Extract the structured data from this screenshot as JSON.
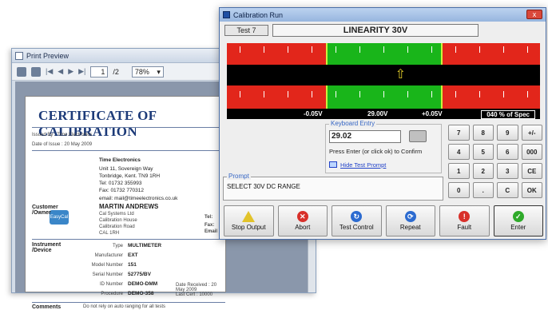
{
  "print_preview": {
    "title": "Print Preview",
    "page_current": "1",
    "page_total": "/2",
    "zoom": "78%",
    "certificate": {
      "title": "CERTIFICATE OF CALIBRATION",
      "issued_by": "Issued By : Time Electronics",
      "date_of_issue": "Date of Issue : 20 May 2009",
      "company": "Time Electronics",
      "address1": "Unit 11, Sovereign Way",
      "address2": "Tonbridge, Kent. TN9 1RH",
      "tel": "Tel: 01732 355993",
      "fax": "Fax: 01732 770312",
      "email": "email: mail@timeelectronics.co.uk",
      "logo_text": "EasyCal",
      "customer_label": "Customer /Owner",
      "customer_name": "MARTIN ANDREWS",
      "customer_line1": "Cal Systems Ltd",
      "customer_line2": "Calibration House",
      "customer_line3": "Calibration Road",
      "customer_line4": "CAL 1RH",
      "tel_short": "Tel:",
      "fax_short": "Fax:",
      "email_short": "Email",
      "instrument_label": "Instrument /Device",
      "type_label": "Type",
      "type_value": "MULTIMETER",
      "manufacturer_label": "Manufacturer",
      "manufacturer_value": "EXT",
      "model_label": "Model Number",
      "model_value": "151",
      "serial_label": "Serial Number",
      "serial_value": "52775/BV",
      "id_label": "ID Number",
      "id_value": "DEMO-DMM",
      "procedure_label": "Procedure",
      "procedure_value": "DEMO-358",
      "date_received": "Date Received : 20 May 2009",
      "last_cert": "Last Cert : 10000",
      "comments_label": "Comments",
      "comments_value": "Do not rely on auto ranging for all tests"
    }
  },
  "calibration_run": {
    "title": "Calibration Run",
    "close_label": "x",
    "test_number": "Test 7",
    "test_name": "LINEARITY 30V",
    "meter": {
      "low_label": "-0.05V",
      "reading": "29.00V",
      "high_label": "+0.05V",
      "spec": "040 % of Spec",
      "pointer_fraction": 0.55
    },
    "keyboard_entry": {
      "title": "Keyboard Entry",
      "value": "29.02",
      "hint": "Press Enter (or click ok) to Confirm",
      "hide_link": "Hide Test Prompt"
    },
    "prompt": {
      "title": "Prompt",
      "text": "SELECT 30V DC RANGE"
    },
    "keypad": [
      "7",
      "8",
      "9",
      "+/-",
      "4",
      "5",
      "6",
      "000",
      "1",
      "2",
      "3",
      "CE",
      "0",
      ".",
      "C",
      "OK"
    ],
    "actions": [
      {
        "label": "Stop Output",
        "icon": "warning-icon",
        "color": "#e2c32a"
      },
      {
        "label": "Abort",
        "icon": "abort-icon",
        "color": "#d8302a"
      },
      {
        "label": "Test Control",
        "icon": "test-control-icon",
        "color": "#2c6bd0"
      },
      {
        "label": "Repeat",
        "icon": "repeat-icon",
        "color": "#2c6bd0"
      },
      {
        "label": "Fault",
        "icon": "fault-icon",
        "color": "#d8302a"
      },
      {
        "label": "Enter",
        "icon": "enter-check-icon",
        "color": "#2faa2a"
      }
    ]
  }
}
